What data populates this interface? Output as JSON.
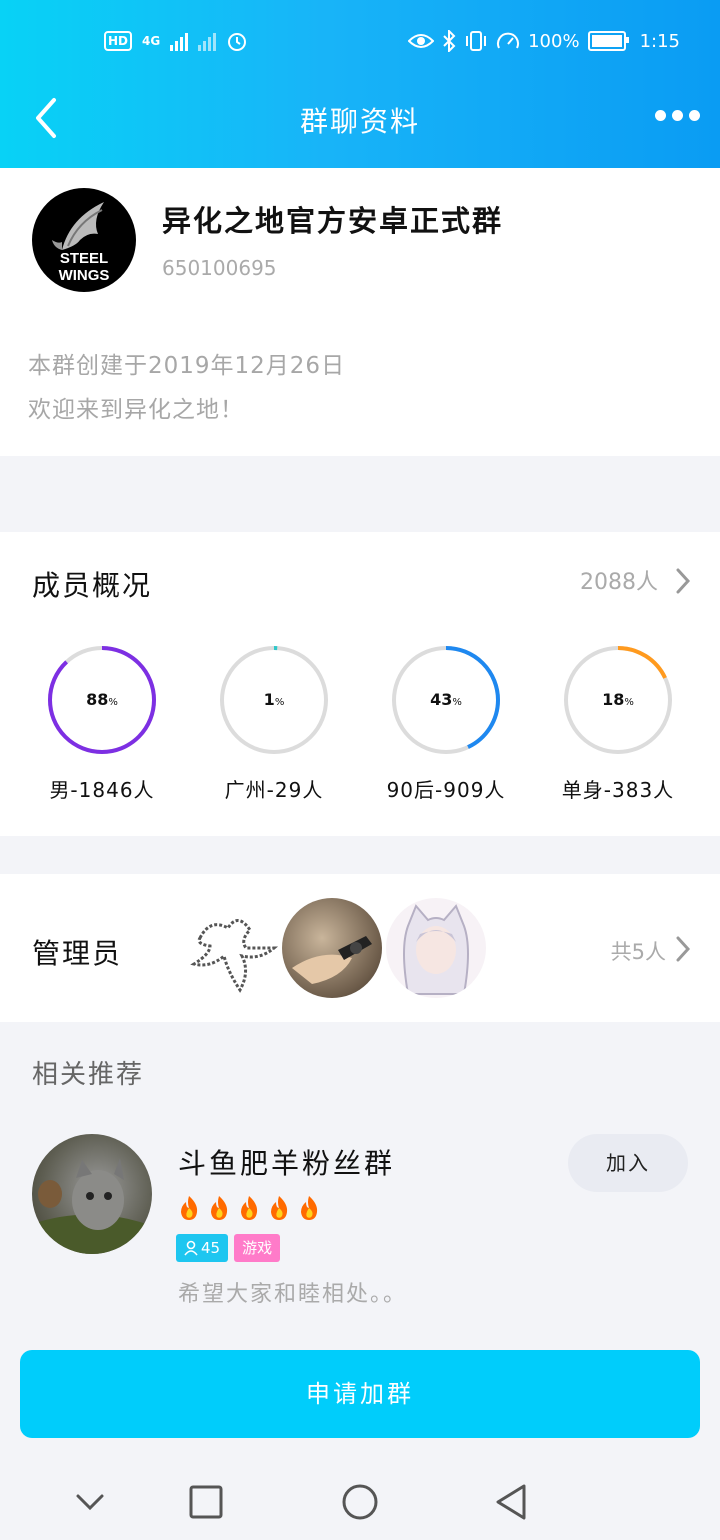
{
  "status_bar": {
    "network_hd": "HD",
    "network_type": "4G",
    "battery": "100%",
    "time": "1:15"
  },
  "header": {
    "title": "群聊资料",
    "back_icon": "chevron-left-icon",
    "more_icon": "more-dots-icon"
  },
  "group": {
    "name": "异化之地官方安卓正式群",
    "id": "650100695",
    "logo_text_1": "STEEL",
    "logo_text_2": "WINGS",
    "description_line1": "本群创建于2019年12月26日",
    "description_line2": "欢迎来到异化之地！"
  },
  "members": {
    "title": "成员概况",
    "count": "2088人",
    "stats": [
      {
        "value": "88",
        "unit": "%",
        "label": "男-1846人",
        "percent": 88,
        "color": "#7d2fe3"
      },
      {
        "value": "1",
        "unit": "%",
        "label": "广州-29人",
        "percent": 1,
        "color": "#2ec7c9"
      },
      {
        "value": "43",
        "unit": "%",
        "label": "90后-909人",
        "percent": 43,
        "color": "#1e88f0"
      },
      {
        "value": "18",
        "unit": "%",
        "label": "单身-383人",
        "percent": 18,
        "color": "#ff9a1e"
      }
    ]
  },
  "admins": {
    "title": "管理员",
    "total": "共5人"
  },
  "recommend": {
    "title": "相关推荐",
    "item": {
      "name": "斗鱼肥羊粉丝群",
      "flames": 5,
      "member_tag": "45",
      "category_tag": "游戏",
      "description": "希望大家和睦相处。。",
      "join_label": "加入"
    }
  },
  "apply_button": "申请加群"
}
